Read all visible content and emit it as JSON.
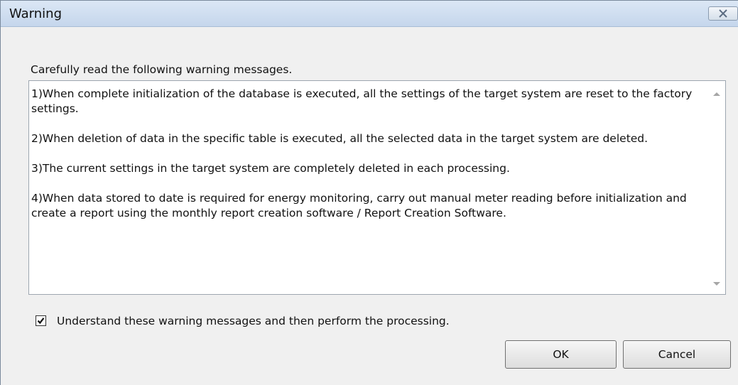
{
  "window": {
    "title": "Warning"
  },
  "icons": {
    "close": "close-icon",
    "scroll_up": "scroll-up-arrow-icon",
    "scroll_down": "scroll-down-arrow-icon",
    "checkmark": "checkmark-icon"
  },
  "dialog": {
    "instruction": "Carefully read the following warning messages.",
    "messages": [
      "1)When complete initialization of the database is executed, all the settings of the target system are reset to the factory settings.",
      "2)When deletion of data in the specific table is executed, all the selected data in the target system are deleted.",
      "3)The current settings in the target system are completely deleted in each processing.",
      "4)When data stored to date is required for energy monitoring, carry out manual meter reading before initialization and create a report using the monthly report creation software / Report Creation Software."
    ],
    "agree_checkbox": {
      "label": "Understand these warning messages and then perform the processing.",
      "checked": true
    }
  },
  "buttons": {
    "ok": "OK",
    "cancel": "Cancel"
  }
}
